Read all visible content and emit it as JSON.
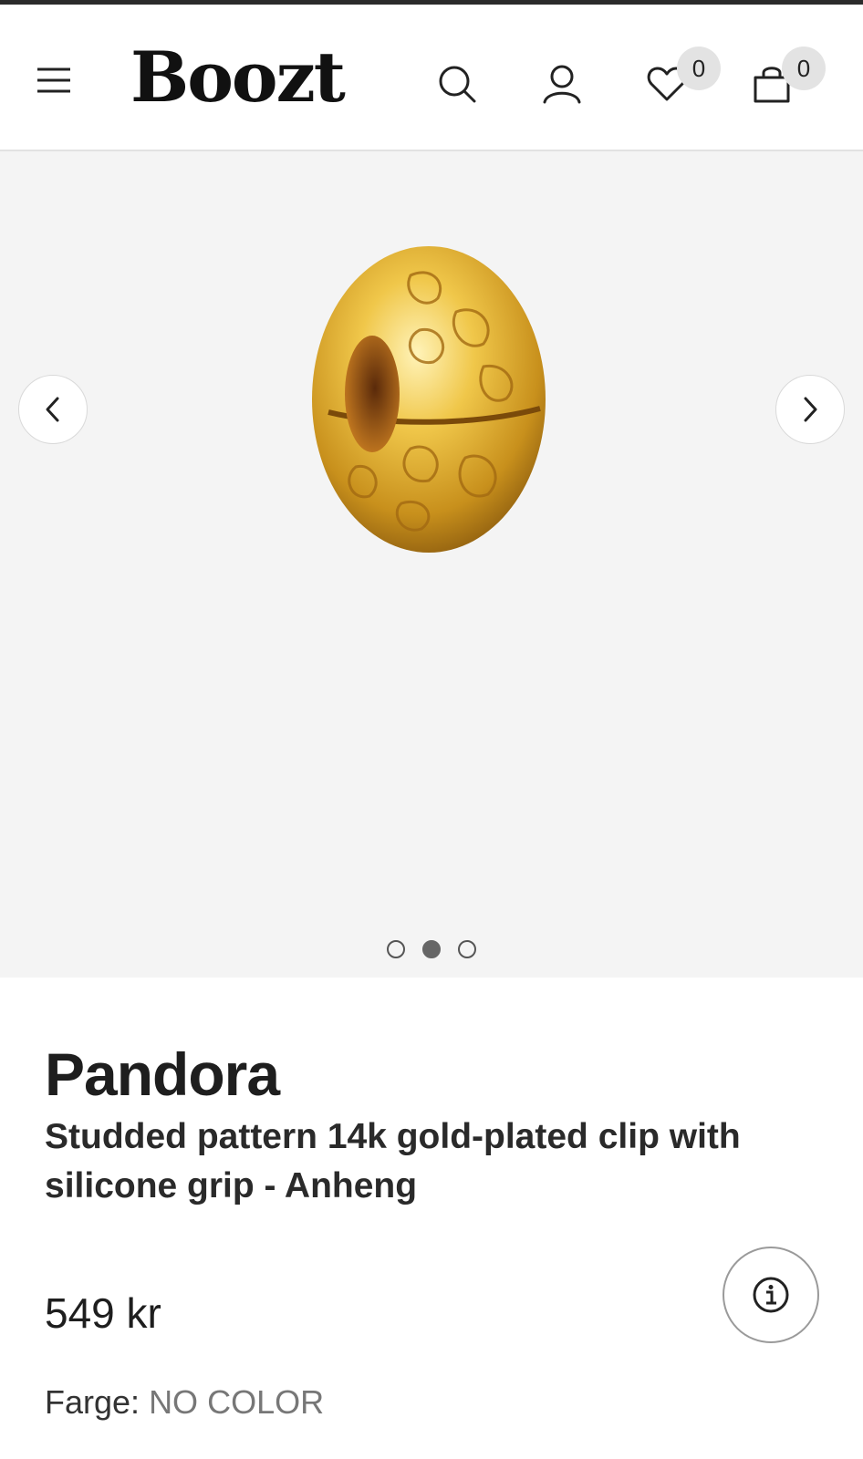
{
  "header": {
    "logo": "Boozt",
    "wishlist_count": "0",
    "bag_count": "0"
  },
  "gallery": {
    "image_alt": "Studded pattern 14k gold-plated clip",
    "image_count": 3,
    "active_index": 1
  },
  "product": {
    "brand": "Pandora",
    "name": "Studded pattern 14k gold-plated clip with silicone grip - Anheng",
    "price": "549 kr",
    "color_label": "Farge:",
    "color_value": "NO COLOR"
  },
  "colors": {
    "gallery_bg": "#f4f4f4",
    "gold": "#d4a62a",
    "text": "#1e1e1e"
  }
}
